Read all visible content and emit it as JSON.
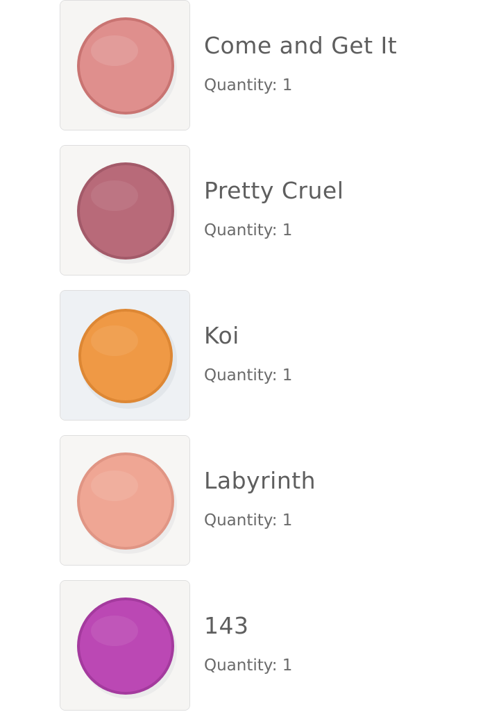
{
  "products": [
    {
      "name": "Come and Get It",
      "quantity_label": "Quantity:",
      "quantity": "1",
      "swatch_color": "#df8f8d",
      "swatch_edge": "#c97472",
      "background": "#f6f5f3"
    },
    {
      "name": "Pretty Cruel",
      "quantity_label": "Quantity:",
      "quantity": "1",
      "swatch_color": "#b86a79",
      "swatch_edge": "#a35a69",
      "background": "#f7f6f4"
    },
    {
      "name": "Koi",
      "quantity_label": "Quantity:",
      "quantity": "1",
      "swatch_color": "#ef9945",
      "swatch_edge": "#dd8734",
      "background": "#eef1f4"
    },
    {
      "name": "Labyrinth",
      "quantity_label": "Quantity:",
      "quantity": "1",
      "swatch_color": "#efa694",
      "swatch_edge": "#e09584",
      "background": "#f7f6f4"
    },
    {
      "name": "143",
      "quantity_label": "Quantity:",
      "quantity": "1",
      "swatch_color": "#bb48b4",
      "swatch_edge": "#a43a9e",
      "background": "#f6f5f3"
    }
  ]
}
